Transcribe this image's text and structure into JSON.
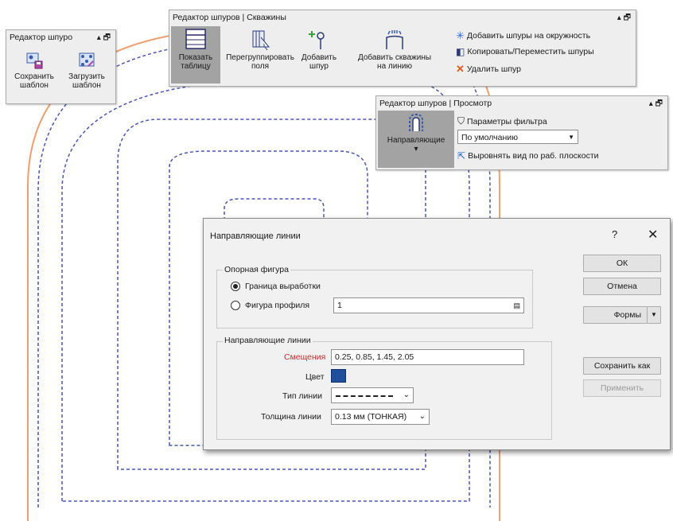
{
  "panel_templates": {
    "title": "Редактор шпуро",
    "controls": "▴ 🗗",
    "save_label": "Сохранить шаблон",
    "load_label": "Загрузить шаблон"
  },
  "panel_holes": {
    "title": "Редактор шпуров | Скважины",
    "controls": "▴ 🗗",
    "show_table_label": "Показать таблицу",
    "regroup_label": "Перегруппировать поля",
    "add_hole_label": "Добавить шпур",
    "add_wells_label": "Добавить скважины на линию",
    "add_circle_label": "Добавить шпуры на окружность",
    "copy_move_label": "Копировать/Переместить шпуры",
    "delete_label": "Удалить шпур"
  },
  "panel_view": {
    "title": "Редактор шпуров | Просмотр",
    "controls": "▴ 🗗",
    "guides_label": "Направляющие",
    "guides_more": "▾",
    "filter_params_label": "Параметры фильтра",
    "filter_select_value": "По умолчанию",
    "align_view_label": "Выровнять вид по раб. плоскости"
  },
  "dialog": {
    "title": "Направляющие линии",
    "help": "?",
    "close": "✕",
    "ref_group_label": "Опорная фигура",
    "radio_boundary": "Граница выработки",
    "radio_profile": "Фигура профиля",
    "profile_value": "1",
    "guides_group_label": "Направляющие линии",
    "offsets_label": "Смещения",
    "offsets_value": "0.25, 0.85, 1.45, 2.05",
    "color_label": "Цвет",
    "color_value": "#1f4e9c",
    "linetype_label": "Тип линии",
    "thickness_label": "Толщина линии",
    "thickness_value": "0.13 мм (ТОНКАЯ)",
    "ok": "ОК",
    "cancel": "Отмена",
    "forms": "Формы",
    "save_as": "Сохранить как",
    "apply": "Применить"
  },
  "colors": {
    "orange_outline": "#f0a070",
    "guide_dashed": "#4a55b5",
    "active_tool": "#a3a3a3"
  }
}
